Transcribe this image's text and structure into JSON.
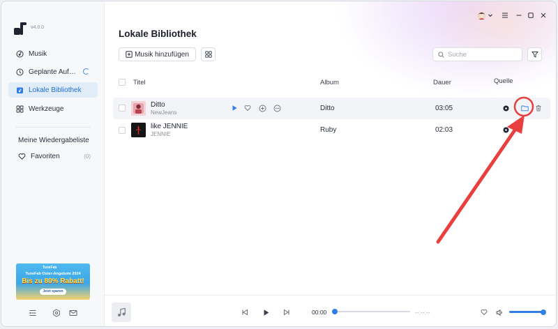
{
  "app": {
    "version": "v4.0.0"
  },
  "sidebar": {
    "items": [
      {
        "label": "Musik",
        "icon": "music-note-icon"
      },
      {
        "label": "Geplante Auf…",
        "icon": "clock-icon"
      },
      {
        "label": "Lokale Bibliothek",
        "icon": "library-icon"
      },
      {
        "label": "Werkzeuge",
        "icon": "grid-icon"
      }
    ],
    "playlists_header": "Meine Wiedergabeliste",
    "favorites": {
      "label": "Favoriten",
      "count": "(0)"
    },
    "promo": {
      "brand": "TuneFab",
      "line1": "TuneFab Oster-Angebote 2024",
      "line2": "Bis zu 80% Rabatt!",
      "cta": "Jetzt sparen"
    }
  },
  "main": {
    "title": "Lokale Bibliothek",
    "add_button": "Musik hinzufügen",
    "search_placeholder": "Suche",
    "columns": {
      "title": "Titel",
      "album": "Album",
      "duration": "Dauer",
      "source": "Quelle"
    },
    "songs": [
      {
        "title": "Ditto",
        "artist": "NewJeans",
        "album": "Ditto",
        "duration": "03:05"
      },
      {
        "title": "like JENNIE",
        "artist": "JENNIE",
        "album": "Ruby",
        "duration": "02:03"
      }
    ]
  },
  "player": {
    "current_time": "00:00",
    "total_time": "--:--:--",
    "progress": 0,
    "volume": 1.0
  },
  "colors": {
    "accent": "#2f7fe6",
    "active_bg": "#e0edf9",
    "annotation": "#e8403f"
  }
}
